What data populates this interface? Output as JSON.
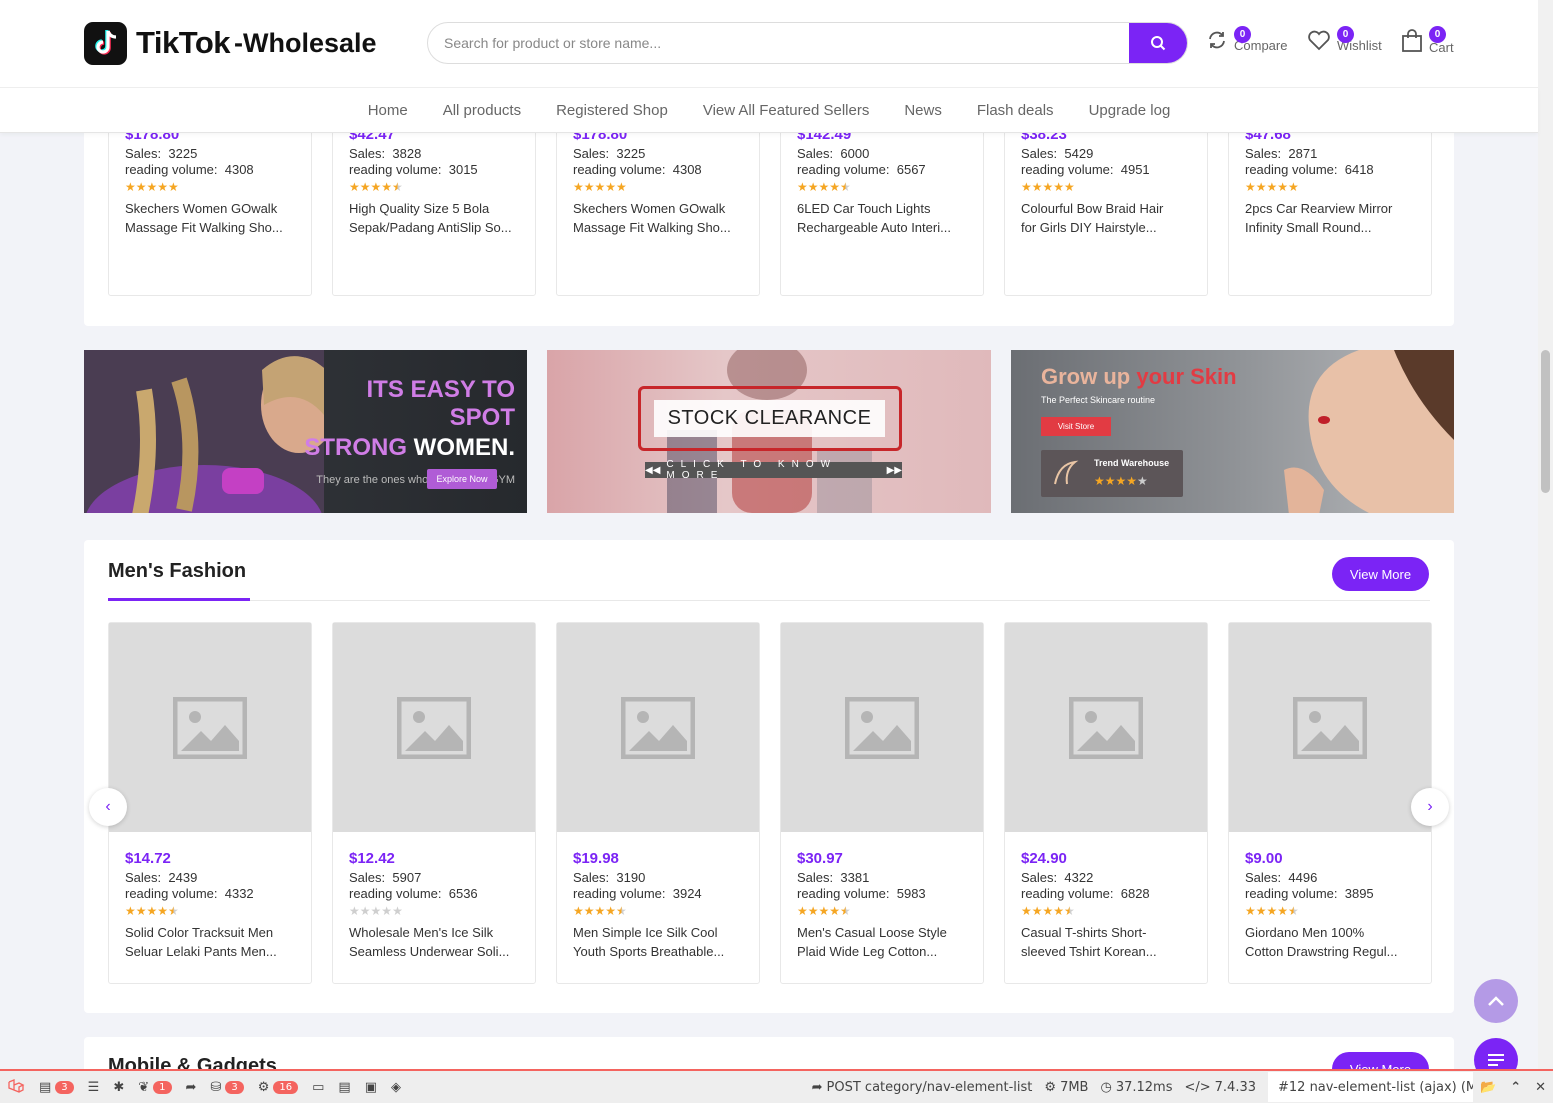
{
  "header": {
    "logo_text": "TikTok",
    "logo_sub": "-Wholesale",
    "search_placeholder": "Search for product or store name...",
    "compare": {
      "label": "Compare",
      "count": "0"
    },
    "wishlist": {
      "label": "Wishlist",
      "count": "0"
    },
    "cart": {
      "label": "Cart",
      "count": "0"
    }
  },
  "nav": [
    "Home",
    "All products",
    "Registered Shop",
    "View All Featured Sellers",
    "News",
    "Flash deals",
    "Upgrade log"
  ],
  "top_products": [
    {
      "price": "$178.80",
      "sales": "3225",
      "reading": "4308",
      "rating": 5,
      "name1": "Skechers Women GOwalk",
      "name2": "Massage Fit Walking Sho..."
    },
    {
      "price": "$42.47",
      "sales": "3828",
      "reading": "3015",
      "rating": 4.5,
      "name1": "High Quality Size 5 Bola",
      "name2": "Sepak/Padang AntiSlip So..."
    },
    {
      "price": "$178.80",
      "sales": "3225",
      "reading": "4308",
      "rating": 5,
      "name1": "Skechers Women GOwalk",
      "name2": "Massage Fit Walking Sho..."
    },
    {
      "price": "$142.49",
      "sales": "6000",
      "reading": "6567",
      "rating": 4.5,
      "name1": "6LED Car Touch Lights",
      "name2": "Rechargeable Auto Interi..."
    },
    {
      "price": "$38.23",
      "sales": "5429",
      "reading": "4951",
      "rating": 5,
      "name1": "Colourful Bow Braid Hair",
      "name2": "for Girls DIY Hairstyle..."
    },
    {
      "price": "$47.68",
      "sales": "2871",
      "reading": "6418",
      "rating": 5,
      "name1": "2pcs Car Rearview Mirror",
      "name2": "Infinity Small Round..."
    }
  ],
  "labels": {
    "sales": "Sales:",
    "reading": "reading volume:"
  },
  "banners": {
    "b1_line1a": "ITS EASY TO SPOT",
    "b1_line2a": "STRONG",
    "b1_line2b": "WOMEN.",
    "b1_sub": "They are the ones who nail it in the GYM",
    "b1_btn": "Explore Now",
    "b2_title": "STOCK CLEARANCE",
    "b2_sub": "CLICK TO KNOW MORE",
    "b3_title_a": "Grow up",
    "b3_title_b": "your Skin",
    "b3_sub": "The Perfect Skincare routine",
    "b3_btn": "Visit Store",
    "b3_store": "Trend Warehouse"
  },
  "mens": {
    "title": "Men's Fashion",
    "view_more": "View More",
    "products": [
      {
        "price": "$14.72",
        "sales": "2439",
        "reading": "4332",
        "rating": 4.5,
        "name1": "Solid Color Tracksuit Men",
        "name2": "Seluar Lelaki Pants Men..."
      },
      {
        "price": "$12.42",
        "sales": "5907",
        "reading": "6536",
        "rating": 0,
        "name1": "Wholesale Men's Ice Silk",
        "name2": "Seamless Underwear Soli..."
      },
      {
        "price": "$19.98",
        "sales": "3190",
        "reading": "3924",
        "rating": 4.5,
        "name1": "Men Simple Ice Silk Cool",
        "name2": "Youth Sports Breathable..."
      },
      {
        "price": "$30.97",
        "sales": "3381",
        "reading": "5983",
        "rating": 4.5,
        "name1": "Men's Casual Loose Style",
        "name2": "Plaid Wide Leg Cotton..."
      },
      {
        "price": "$24.90",
        "sales": "4322",
        "reading": "6828",
        "rating": 4.5,
        "name1": "Casual T-shirts Short-",
        "name2": "sleeved Tshirt Korean..."
      },
      {
        "price": "$9.00",
        "sales": "4496",
        "reading": "3895",
        "rating": 4.5,
        "name1": "Giordano Men 100%",
        "name2": "Cotton Drawstring Regul..."
      }
    ]
  },
  "next_section": {
    "title": "Mobile & Gadgets",
    "view_more": "View More"
  },
  "debugbar": {
    "messages": "3",
    "timeline": "",
    "exceptions": "",
    "views": "1",
    "route": "",
    "queries": "3",
    "models": "16",
    "request": "POST category/nav-element-list",
    "memory": "7MB",
    "time": "37.12ms",
    "php": "7.4.33",
    "ajax": "#12 nav-element-list (ajax) (M"
  },
  "colors": {
    "accent": "#7b24f5",
    "star": "#f5a623",
    "debug": "#f4645f"
  }
}
